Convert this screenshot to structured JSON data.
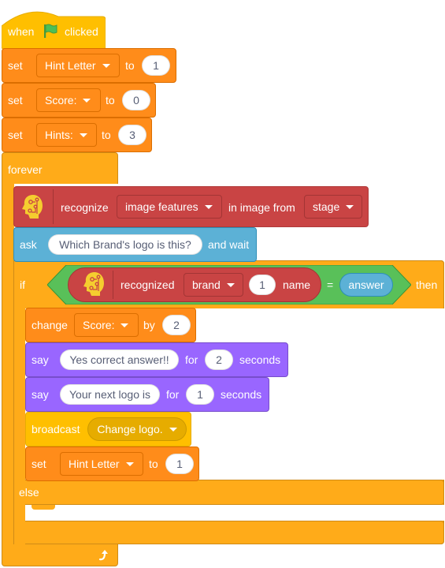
{
  "script": {
    "hat": {
      "word_when": "when",
      "flag_icon": "green-flag-icon",
      "word_clicked": "clicked"
    },
    "set_hint_letter": {
      "keyword": "set",
      "variable": "Hint Letter",
      "to": "to",
      "value": "1"
    },
    "set_score": {
      "keyword": "set",
      "variable": "Score:",
      "to": "to",
      "value": "0"
    },
    "set_hints": {
      "keyword": "set",
      "variable": "Hints:",
      "to": "to",
      "value": "3"
    },
    "forever": {
      "label": "forever",
      "loop_icon": "loop-arrow-icon"
    },
    "recognize": {
      "icon": "ml-head-icon",
      "keyword": "recognize",
      "feature": "image features",
      "in_image_from": "in image from",
      "source": "stage"
    },
    "ask": {
      "keyword": "ask",
      "question": "Which Brand's logo is this?",
      "and_wait": "and wait"
    },
    "if_block": {
      "if": "if",
      "condition": {
        "reporter": {
          "icon": "ml-head-icon",
          "keyword": "recognized",
          "class_name": "brand",
          "index": "1",
          "name": "name"
        },
        "operator": "=",
        "right": "answer"
      },
      "then": "then",
      "else": "else"
    },
    "change_score": {
      "keyword": "change",
      "variable": "Score:",
      "by": "by",
      "value": "2"
    },
    "say_correct": {
      "keyword": "say",
      "message": "Yes correct answer!!",
      "for": "for",
      "secs": "2",
      "seconds": "seconds"
    },
    "say_next": {
      "keyword": "say",
      "message": "Your next logo is",
      "for": "for",
      "secs": "1",
      "seconds": "seconds"
    },
    "broadcast": {
      "keyword": "broadcast",
      "message": "Change logo."
    },
    "set_hint_letter_2": {
      "keyword": "set",
      "variable": "Hint Letter",
      "to": "to",
      "value": "1"
    }
  },
  "colors": {
    "events": "#ffbf00",
    "variables": "#ff8c1a",
    "control": "#ffab19",
    "ml": "#c94444",
    "sensing": "#5cb1d6",
    "looks": "#9966ff",
    "operators": "#59c059"
  }
}
